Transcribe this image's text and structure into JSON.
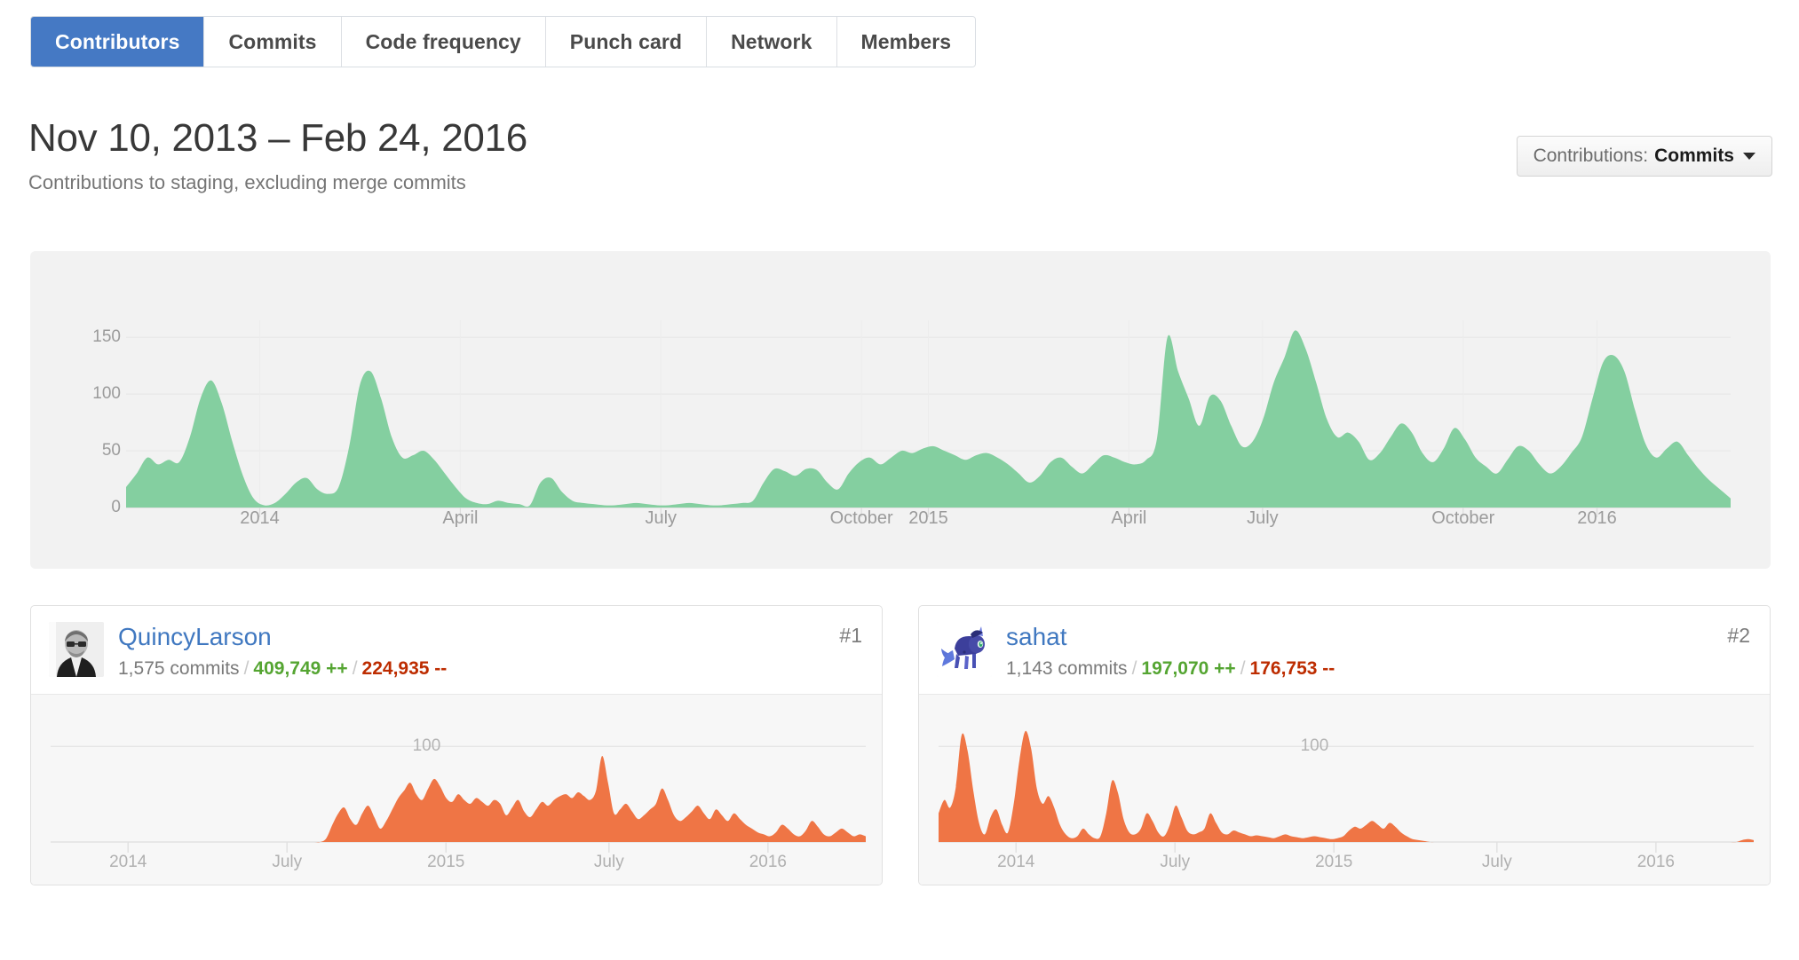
{
  "colors": {
    "tab_active_bg": "#4579c4",
    "link": "#4078c0",
    "main_area_fill": "#84cfa0",
    "mini_area_fill": "#ef7545",
    "additions": "#55a532",
    "deletions": "#bd2c00",
    "panel_bg": "#f2f2f2",
    "card_chart_bg": "#f7f7f7"
  },
  "tabs": [
    {
      "label": "Contributors",
      "selected": true
    },
    {
      "label": "Commits",
      "selected": false
    },
    {
      "label": "Code frequency",
      "selected": false
    },
    {
      "label": "Punch card",
      "selected": false
    },
    {
      "label": "Network",
      "selected": false
    },
    {
      "label": "Members",
      "selected": false
    }
  ],
  "header": {
    "title": "Nov 10, 2013 – Feb 24, 2016",
    "subtitle": "Contributions to staging, excluding merge commits"
  },
  "contributions_select": {
    "label": "Contributions:",
    "value": "Commits",
    "caret_icon": "chevron-down-icon"
  },
  "chart_data": [
    {
      "id": "main-contributions-chart",
      "type": "area",
      "title": "Nov 10, 2013 – Feb 24, 2016",
      "xlabel": "",
      "ylabel": "",
      "ylim": [
        0,
        165
      ],
      "grid": true,
      "legend_position": "none",
      "ytick_labels": [
        "150",
        "100",
        "50",
        "0"
      ],
      "ytick_values": [
        150,
        100,
        50,
        0
      ],
      "xtick_labels": [
        "2014",
        "April",
        "July",
        "October",
        "2015",
        "April",
        "July",
        "October",
        "2016"
      ],
      "xtick_positions": [
        0.0833,
        0.2083,
        0.3333,
        0.4583,
        0.5,
        0.625,
        0.7083,
        0.8333,
        0.9167
      ],
      "series": [
        {
          "name": "Commits",
          "color": "#84cfa0",
          "values": [
            18,
            30,
            44,
            38,
            42,
            40,
            62,
            96,
            112,
            92,
            58,
            28,
            8,
            2,
            4,
            12,
            22,
            26,
            16,
            12,
            18,
            54,
            108,
            120,
            96,
            62,
            44,
            46,
            50,
            42,
            30,
            18,
            8,
            4,
            3,
            6,
            4,
            3,
            2,
            22,
            26,
            14,
            6,
            4,
            3,
            2,
            2,
            3,
            4,
            3,
            2,
            2,
            3,
            4,
            3,
            2,
            2,
            3,
            4,
            6,
            22,
            34,
            32,
            28,
            34,
            33,
            22,
            16,
            30,
            40,
            44,
            38,
            44,
            50,
            48,
            52,
            54,
            50,
            46,
            42,
            46,
            48,
            44,
            38,
            30,
            22,
            28,
            40,
            44,
            36,
            30,
            38,
            46,
            44,
            40,
            38,
            42,
            60,
            150,
            120,
            96,
            72,
            98,
            94,
            72,
            54,
            58,
            78,
            110,
            132,
            156,
            140,
            110,
            78,
            62,
            66,
            58,
            42,
            48,
            62,
            74,
            66,
            48,
            40,
            52,
            70,
            60,
            44,
            36,
            30,
            42,
            54,
            50,
            38,
            30,
            36,
            48,
            62,
            96,
            128,
            134,
            120,
            86,
            56,
            44,
            52,
            58,
            46,
            34,
            24,
            16,
            8
          ]
        }
      ]
    },
    {
      "id": "contributor-1-chart",
      "type": "area",
      "title": "QuincyLarson commits over time",
      "ylim": [
        0,
        130
      ],
      "grid": true,
      "legend_position": "none",
      "ytick_labels": [
        "100"
      ],
      "ytick_values": [
        100
      ],
      "xtick_labels": [
        "2014",
        "July",
        "2015",
        "July",
        "2016"
      ],
      "xtick_positions": [
        0.095,
        0.29,
        0.485,
        0.685,
        0.88
      ],
      "series": [
        {
          "name": "Commits",
          "color": "#ef7545",
          "values": [
            0,
            0,
            0,
            0,
            0,
            0,
            0,
            0,
            0,
            0,
            0,
            0,
            0,
            0,
            0,
            0,
            0,
            0,
            0,
            0,
            0,
            0,
            0,
            0,
            0,
            0,
            0,
            0,
            0,
            0,
            0,
            0,
            0,
            0,
            0,
            0,
            0,
            0,
            0,
            0,
            0,
            0,
            0,
            0,
            0,
            0,
            4,
            18,
            30,
            36,
            24,
            18,
            30,
            38,
            26,
            14,
            22,
            34,
            46,
            54,
            62,
            50,
            44,
            56,
            66,
            58,
            46,
            42,
            50,
            44,
            40,
            46,
            42,
            38,
            44,
            40,
            28,
            36,
            44,
            32,
            26,
            34,
            42,
            38,
            44,
            48,
            50,
            46,
            52,
            48,
            44,
            54,
            90,
            62,
            30,
            34,
            40,
            32,
            24,
            28,
            34,
            40,
            56,
            44,
            28,
            22,
            26,
            32,
            38,
            30,
            24,
            34,
            28,
            22,
            30,
            24,
            18,
            14,
            10,
            8,
            6,
            10,
            18,
            14,
            8,
            6,
            12,
            22,
            16,
            8,
            6,
            10,
            14,
            10,
            6,
            8,
            6
          ]
        }
      ]
    },
    {
      "id": "contributor-2-chart",
      "type": "area",
      "title": "sahat commits over time",
      "ylim": [
        0,
        130
      ],
      "grid": true,
      "legend_position": "none",
      "ytick_labels": [
        "100"
      ],
      "ytick_values": [
        100
      ],
      "xtick_labels": [
        "2014",
        "July",
        "2015",
        "July",
        "2016"
      ],
      "xtick_positions": [
        0.095,
        0.29,
        0.485,
        0.685,
        0.88
      ],
      "series": [
        {
          "name": "Commits",
          "color": "#ef7545",
          "values": [
            30,
            44,
            36,
            58,
            112,
            96,
            54,
            20,
            8,
            26,
            34,
            18,
            10,
            40,
            86,
            116,
            98,
            56,
            40,
            48,
            36,
            18,
            8,
            4,
            6,
            14,
            8,
            4,
            6,
            30,
            64,
            52,
            24,
            10,
            8,
            14,
            30,
            22,
            10,
            6,
            18,
            38,
            26,
            12,
            8,
            10,
            14,
            30,
            20,
            10,
            8,
            12,
            10,
            8,
            6,
            7,
            6,
            5,
            4,
            6,
            8,
            6,
            5,
            4,
            5,
            6,
            5,
            4,
            3,
            4,
            6,
            12,
            16,
            14,
            18,
            22,
            18,
            14,
            20,
            16,
            10,
            6,
            3,
            2,
            1,
            0,
            0,
            0,
            0,
            0,
            0,
            0,
            0,
            0,
            0,
            0,
            0,
            0,
            0,
            0,
            0,
            0,
            0,
            0,
            0,
            0,
            0,
            0,
            0,
            0,
            0,
            0,
            0,
            0,
            0,
            0,
            0,
            0,
            0,
            0,
            0,
            0,
            0,
            0,
            0,
            0,
            0,
            0,
            0,
            0,
            0,
            0,
            0,
            0,
            0,
            0,
            0,
            0,
            0,
            2,
            3,
            2
          ]
        }
      ]
    }
  ],
  "contributors": [
    {
      "username": "QuincyLarson",
      "rank": "#1",
      "commits": "1,575 commits",
      "additions": "409,749 ++",
      "deletions": "224,935 --",
      "avatar_icon": "avatar-photo-quincylarson",
      "chart_id": "contributor-1-chart"
    },
    {
      "username": "sahat",
      "rank": "#2",
      "commits": "1,143 commits",
      "additions": "197,070 ++",
      "deletions": "176,753 --",
      "avatar_icon": "avatar-pony-sahat",
      "chart_id": "contributor-2-chart"
    }
  ]
}
